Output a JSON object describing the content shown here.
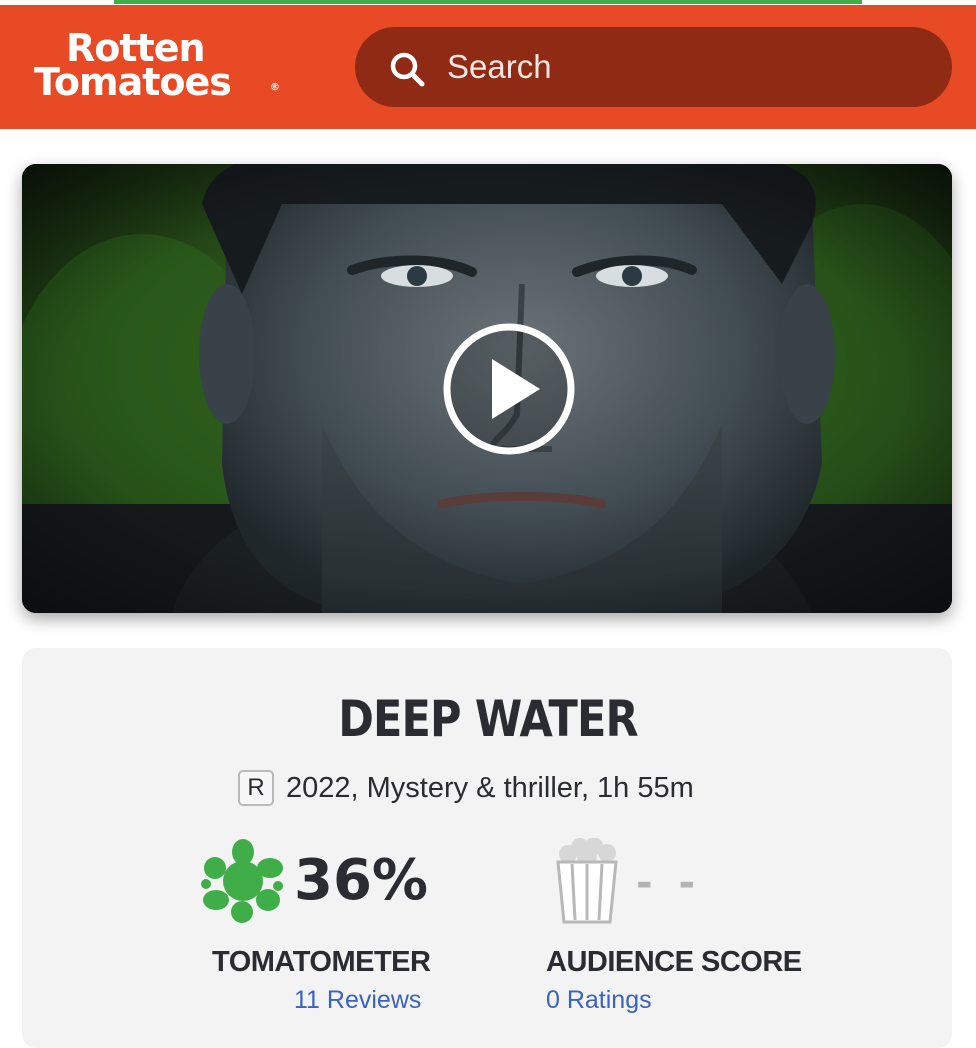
{
  "header": {
    "logo_line1": "Rotten",
    "logo_line2": "Tomatoes",
    "logo_mark": "®",
    "search_placeholder": "Search",
    "background_color": "#e74a24",
    "search_color": "#8f2a14"
  },
  "video": {
    "play_icon": "play-icon"
  },
  "movie": {
    "title": "DEEP WATER",
    "rating": "R",
    "info": "2022, Mystery & thriller, 1h 55m"
  },
  "scores": {
    "tomatometer": {
      "score": "36%",
      "label": "TOMATOMETER",
      "link": "11 Reviews",
      "icon": "splat-icon",
      "color": "#3fae49"
    },
    "audience": {
      "score": "- -",
      "label": "AUDIENCE SCORE",
      "link": "0 Ratings",
      "icon": "popcorn-icon"
    }
  }
}
